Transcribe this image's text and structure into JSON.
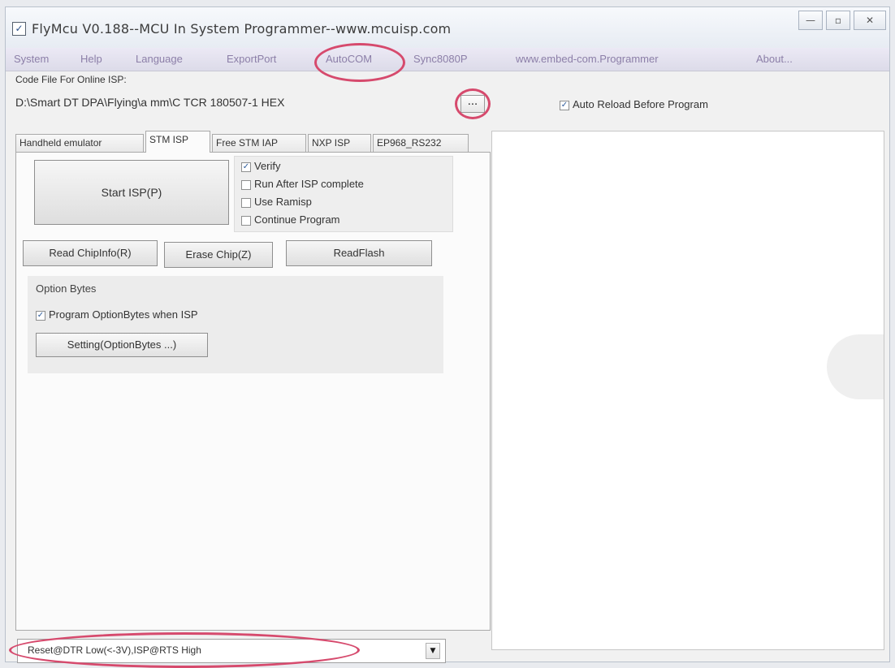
{
  "window": {
    "title": "FlyMcu V0.188--MCU In System Programmer--www.mcuisp.com",
    "controls": [
      "—",
      "▫",
      "✕"
    ]
  },
  "menu": {
    "items": [
      "System",
      "Help",
      "Language",
      "ExportPort",
      "AutoCOM",
      "Sync8080P",
      "www.embed-com.Programmer",
      "About..."
    ]
  },
  "code_file": {
    "label": "Code File For Online ISP:",
    "path": "D:\\Smart DT DPA\\Flying\\a mm\\C TCR 180507-1 HEX",
    "browse": "..."
  },
  "auto_reload": {
    "label": "Auto Reload Before Program",
    "checked": true
  },
  "tabs": [
    "Handheld emulator",
    "STM ISP",
    "Free STM IAP",
    "NXP ISP",
    "EP968_RS232"
  ],
  "isp": {
    "start_button": "Start ISP(P)",
    "options": [
      {
        "label": "Verify",
        "checked": true
      },
      {
        "label": "Run After ISP complete",
        "checked": false
      },
      {
        "label": "Use Ramisp",
        "checked": false
      },
      {
        "label": "Continue Program",
        "checked": false
      }
    ],
    "read_button": "Read ChipInfo(R)",
    "erase_button": "Erase Chip(Z)",
    "read_flash_button": "ReadFlash"
  },
  "option_bytes": {
    "title": "Option Bytes",
    "program_label": "Program OptionBytes when ISP",
    "program_checked": true,
    "setting_button": "Setting(OptionBytes ...)"
  },
  "bottom_combo": {
    "value": "Reset@DTR Low(<-3V),ISP@RTS High",
    "arrow": "▼"
  },
  "icons": {
    "app": "✓"
  },
  "colors": {
    "highlight": "#d64a6d",
    "menu_text": "#8c7fa8"
  }
}
